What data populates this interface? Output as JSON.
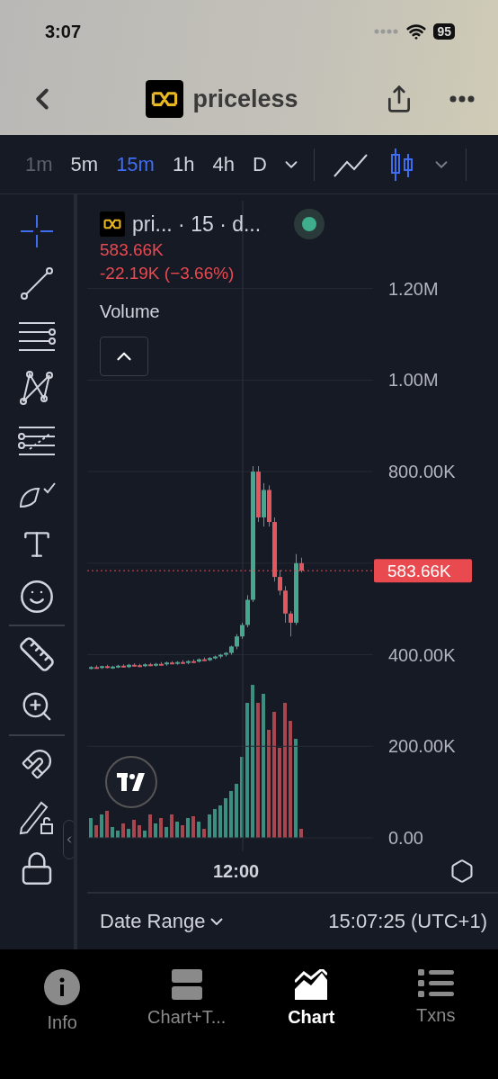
{
  "status_bar": {
    "time": "3:07",
    "battery": "95"
  },
  "header": {
    "title": "priceless"
  },
  "timeframes": [
    {
      "label": "1m",
      "selected": false,
      "disabled": true
    },
    {
      "label": "5m",
      "selected": false,
      "disabled": false
    },
    {
      "label": "15m",
      "selected": true,
      "disabled": false
    },
    {
      "label": "1h",
      "selected": false,
      "disabled": false
    },
    {
      "label": "4h",
      "selected": false,
      "disabled": false
    },
    {
      "label": "D",
      "selected": false,
      "disabled": false
    }
  ],
  "chart_types": [
    {
      "kind": "line",
      "selected": false
    },
    {
      "kind": "candles",
      "selected": true
    }
  ],
  "tools": [
    {
      "kind": "crosshair",
      "selected": true
    },
    {
      "kind": "trend",
      "selected": false
    },
    {
      "kind": "hlines",
      "selected": false
    },
    {
      "kind": "pattern",
      "selected": false
    },
    {
      "kind": "fib",
      "selected": false
    },
    {
      "kind": "brush",
      "selected": false
    },
    {
      "kind": "text",
      "selected": false
    },
    {
      "kind": "emoji",
      "selected": false
    },
    {
      "kind": "divider"
    },
    {
      "kind": "ruler",
      "selected": false
    },
    {
      "kind": "zoom",
      "selected": false
    },
    {
      "kind": "divider"
    },
    {
      "kind": "magnet",
      "selected": false
    },
    {
      "kind": "pencil-lock",
      "selected": false
    },
    {
      "kind": "lock",
      "selected": false
    }
  ],
  "legend": {
    "title": "pri... · 15 · d...",
    "price": "583.66K",
    "change": "-22.19K (−3.66%)",
    "volume_label": "Volume"
  },
  "chart": {
    "time_label": "12:00",
    "current_price": "583.66K",
    "chart_data": {
      "type": "candlestick",
      "grid": true,
      "ylim": [
        0,
        1392000
      ],
      "yticks": [
        {
          "value": 1200000,
          "label": "1.20M"
        },
        {
          "value": 1000000,
          "label": "1.00M"
        },
        {
          "value": 800000,
          "label": "800.00K"
        },
        {
          "value": 400000,
          "label": "400.00K"
        },
        {
          "value": 200000,
          "label": "200.00K"
        },
        {
          "value": 0,
          "label": "0.00"
        }
      ],
      "ohlc": [
        [
          370000,
          375000,
          368000,
          373000
        ],
        [
          373000,
          377000,
          370000,
          372000
        ],
        [
          372000,
          376000,
          369000,
          375000
        ],
        [
          375000,
          378000,
          370000,
          371000
        ],
        [
          371000,
          376000,
          369000,
          374000
        ],
        [
          374000,
          378000,
          371000,
          376000
        ],
        [
          376000,
          379000,
          372000,
          373000
        ],
        [
          373000,
          380000,
          371000,
          378000
        ],
        [
          378000,
          381000,
          374000,
          377000
        ],
        [
          377000,
          380000,
          373000,
          375000
        ],
        [
          375000,
          381000,
          373000,
          379000
        ],
        [
          379000,
          382000,
          375000,
          377000
        ],
        [
          377000,
          382000,
          374000,
          380000
        ],
        [
          380000,
          384000,
          377000,
          379000
        ],
        [
          379000,
          385000,
          376000,
          383000
        ],
        [
          383000,
          386000,
          379000,
          381000
        ],
        [
          381000,
          386000,
          378000,
          384000
        ],
        [
          384000,
          388000,
          380000,
          382000
        ],
        [
          382000,
          388000,
          379000,
          386000
        ],
        [
          386000,
          390000,
          382000,
          385000
        ],
        [
          385000,
          392000,
          383000,
          390000
        ],
        [
          390000,
          394000,
          386000,
          388000
        ],
        [
          388000,
          395000,
          386000,
          393000
        ],
        [
          393000,
          398000,
          390000,
          396000
        ],
        [
          396000,
          402000,
          392000,
          400000
        ],
        [
          400000,
          406000,
          396000,
          404000
        ],
        [
          404000,
          420000,
          400000,
          418000
        ],
        [
          418000,
          445000,
          412000,
          440000
        ],
        [
          440000,
          470000,
          435000,
          465000
        ],
        [
          465000,
          530000,
          460000,
          520000
        ],
        [
          520000,
          812000,
          515000,
          800000
        ],
        [
          800000,
          812000,
          690000,
          700000
        ],
        [
          700000,
          775000,
          680000,
          760000
        ],
        [
          760000,
          770000,
          680000,
          690000
        ],
        [
          690000,
          700000,
          560000,
          570000
        ],
        [
          570000,
          585000,
          530000,
          540000
        ],
        [
          540000,
          550000,
          470000,
          490000
        ],
        [
          490000,
          495000,
          440000,
          470000
        ],
        [
          470000,
          620000,
          465000,
          600000
        ],
        [
          600000,
          612000,
          580000,
          583660
        ]
      ]
    }
  },
  "footer": {
    "date_range": "Date Range",
    "clock": "15:07:25 (UTC+1)"
  },
  "nav_tabs": [
    {
      "kind": "info",
      "label": "Info",
      "selected": false
    },
    {
      "kind": "split",
      "label": "Chart+T...",
      "selected": false
    },
    {
      "kind": "chart",
      "label": "Chart",
      "selected": true
    },
    {
      "kind": "list",
      "label": "Txns",
      "selected": false
    }
  ]
}
